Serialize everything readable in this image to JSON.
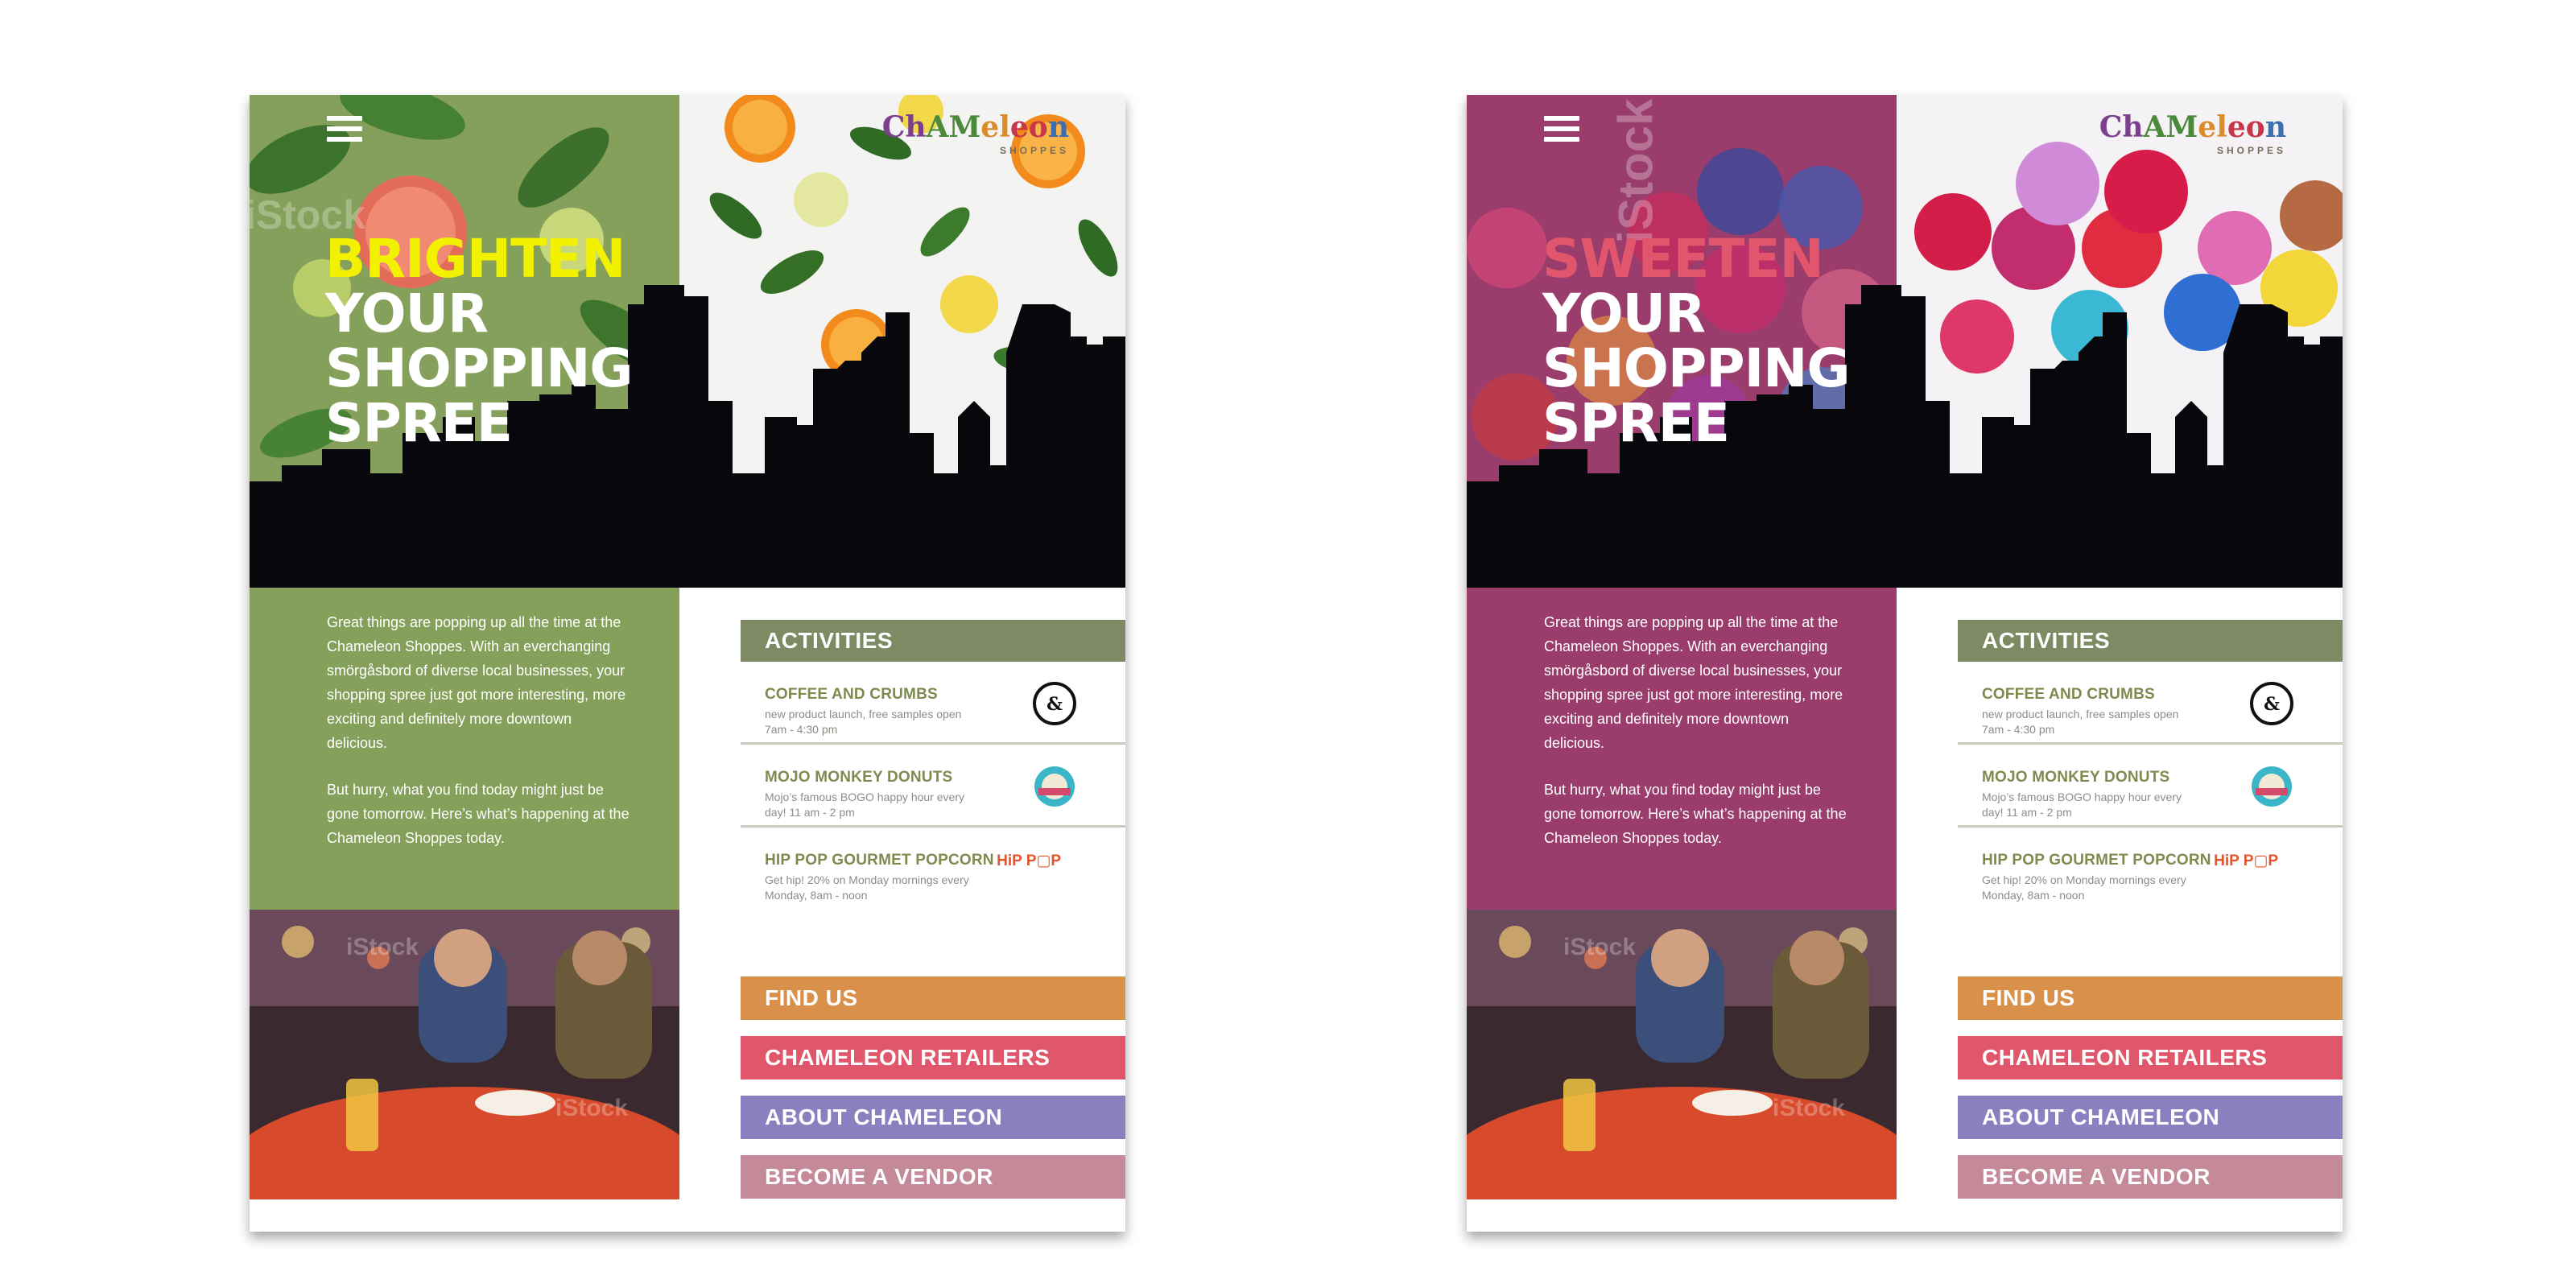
{
  "colors": {
    "text_gray": "#8c8c86",
    "activity_name": "#7d8b4f",
    "activities_bar": "#7d8a63",
    "find_us": "#d8904a",
    "retailers": "#e0566b",
    "about": "#8c7fbf",
    "vendor": "#c48a9a"
  },
  "logo": {
    "word_parts": [
      "Ch",
      "AM",
      "el",
      "eo",
      "n"
    ],
    "sub": "SHOPPES"
  },
  "variants": [
    {
      "id": "citrus",
      "accent_word": "BRIGHTEN",
      "accent_color": "#f2f200",
      "panel_color": "#84a05a",
      "headline_rest": [
        "YOUR",
        "SHOPPING",
        "SPREE"
      ]
    },
    {
      "id": "candy",
      "accent_word": "SWEETEN",
      "accent_color": "#e2566d",
      "panel_color": "#9a3d6c",
      "headline_rest": [
        "YOUR",
        "SHOPPING",
        "SPREE"
      ]
    }
  ],
  "intro": {
    "p1": "Great things are popping up all the time at the Chameleon Shoppes. With an everchanging smörgåsbord of diverse local businesses, your shopping spree just got more interesting, more exciting and definitely more downtown delicious.",
    "p2": "But hurry, what you find today might just be gone tomorrow. Here’s what’s happening at the Chameleon Shoppes today."
  },
  "activities": {
    "title": "ACTIVITIES",
    "items": [
      {
        "name": "COFFEE AND CRUMBS",
        "desc": "new product launch, free samples open 7am - 4:30 pm",
        "icon": "coffee-and-crumbs-logo-icon"
      },
      {
        "name": "MOJO MONKEY DONUTS",
        "desc": "Mojo’s famous BOGO happy hour every day! 11 am - 2 pm",
        "icon": "mojo-monkey-logo-icon"
      },
      {
        "name": "HIP POP GOURMET POPCORN",
        "desc": "Get hip! 20% on Monday mornings every Monday, 8am - noon",
        "icon": "hip-pop-logo-icon",
        "logo_text": "HiP P▢P"
      }
    ]
  },
  "nav": {
    "find_us": "FIND US",
    "retailers": "CHAMELEON RETAILERS",
    "about": "ABOUT CHAMELEON",
    "vendor": "BECOME A VENDOR"
  },
  "watermark": "iStock"
}
